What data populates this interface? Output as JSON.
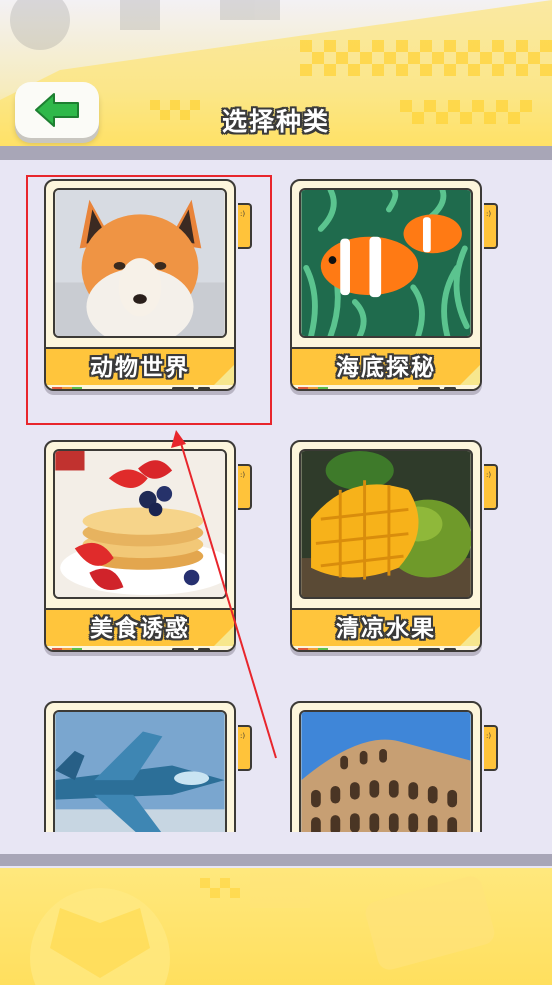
{
  "header": {
    "title": "选择种类",
    "back_icon": "arrow-left-icon"
  },
  "categories": [
    {
      "label": "动物世界",
      "image": "fox-photo"
    },
    {
      "label": "海底探秘",
      "image": "clownfish-photo"
    },
    {
      "label": "美食诱惑",
      "image": "pancakes-photo"
    },
    {
      "label": "清凉水果",
      "image": "mango-photo"
    },
    {
      "label": "",
      "image": "fighter-jet-photo"
    },
    {
      "label": "",
      "image": "colosseum-photo"
    }
  ],
  "colors": {
    "accent_yellow": "#ffc53c",
    "back_arrow_green": "#2fb84a",
    "annotation_red": "#e8262c",
    "background": "#e8e6f4"
  }
}
